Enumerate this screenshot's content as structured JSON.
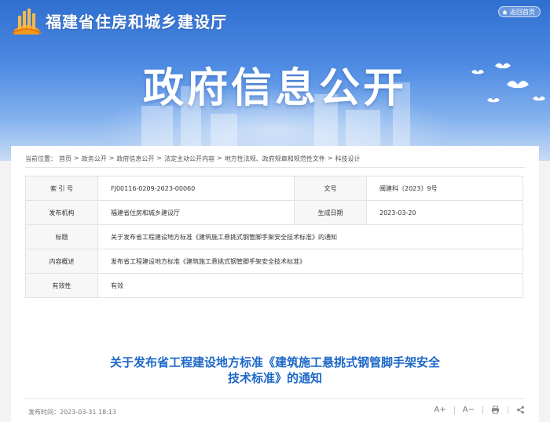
{
  "header": {
    "site_title": "福建省住房和城乡建设厅",
    "back_home": "返回首页",
    "banner_title": "政府信息公开"
  },
  "breadcrumb": {
    "prefix": "当前位置：",
    "items": [
      "首页",
      "政务公开",
      "政府信息公开",
      "法定主动公开内容",
      "地方性法规、政府规章和规范性文件",
      "科技设计"
    ],
    "separator": ">"
  },
  "info_table": {
    "index_label": "索 引 号",
    "index_value": "FJ00116-0209-2023-00060",
    "doc_no_label": "文号",
    "doc_no_value": "闽建科〔2023〕9号",
    "issuer_label": "发布机构",
    "issuer_value": "福建省住房和城乡建设厅",
    "date_label": "生成日期",
    "date_value": "2023-03-20",
    "title_label": "标题",
    "title_value": "关于发布省工程建设地方标准《建筑施工悬挑式钢管脚手架安全技术标准》的通知",
    "summary_label": "内容概述",
    "summary_value": "发布省工程建设地方标准《建筑施工悬挑式钢管脚手架安全技术标准》",
    "validity_label": "有效性",
    "validity_value": "有效"
  },
  "article": {
    "title_line1": "关于发布省工程建设地方标准《建筑施工悬挑式钢管脚手架安全",
    "title_line2": "技术标准》的通知",
    "publish_time": "发布时间：2023-03-31 18:13",
    "font_increase": "A+",
    "font_decrease": "A−"
  },
  "colors": {
    "banner_top": "#2f6fd0",
    "title_blue": "#1d68c8"
  }
}
